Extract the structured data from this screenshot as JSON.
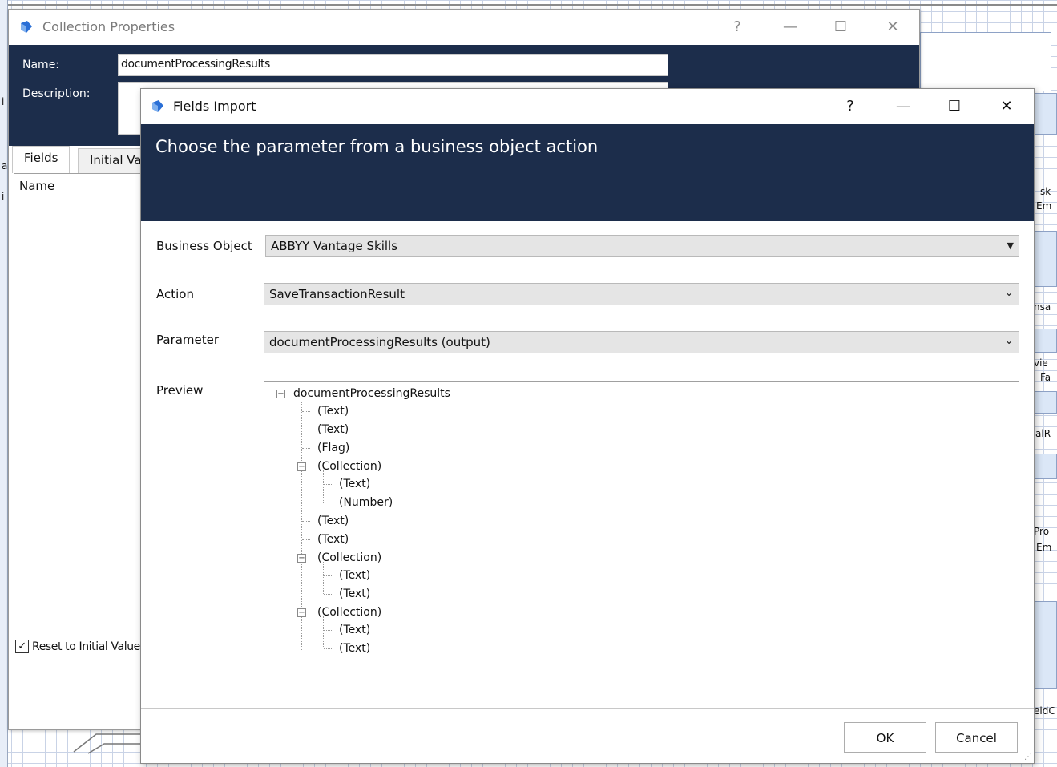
{
  "background": {
    "fragments": [
      "sk",
      "Em",
      "nsa",
      "vie",
      "Fa",
      "alR",
      "Pro",
      "Em",
      "eldC",
      "i",
      "a",
      "i"
    ]
  },
  "collection_properties": {
    "title": "Collection Properties",
    "name_label": "Name:",
    "name_value": "documentProcessingResults",
    "description_label": "Description:",
    "description_value": "",
    "tabs": [
      "Fields",
      "Initial Va"
    ],
    "list_column": "Name",
    "reset_label": "Reset to Initial Value",
    "reset_checked": "✓",
    "help": "?",
    "minimize": "—",
    "maximize": "☐",
    "close": "✕"
  },
  "fields_import": {
    "title": "Fields Import",
    "help": "?",
    "minimize": "—",
    "maximize": "☐",
    "close": "✕",
    "heading": "Choose the parameter from a business object action",
    "business_object_label": "Business Object",
    "business_object_value": "ABBYY Vantage Skills",
    "action_label": "Action",
    "action_value": "SaveTransactionResult",
    "parameter_label": "Parameter",
    "parameter_value": "documentProcessingResults (output)",
    "preview_label": "Preview",
    "tree": {
      "root": "documentProcessingResults",
      "nodes": [
        "(Text)",
        "(Text)",
        "(Flag)",
        "(Collection)",
        "(Text)",
        "(Number)",
        "(Text)",
        "(Text)",
        "(Collection)",
        "(Text)",
        "(Text)",
        "(Collection)",
        "(Text)",
        "(Text)"
      ]
    },
    "ok_label": "OK",
    "cancel_label": "Cancel",
    "expand_glyph": "−",
    "dropdown_glyph": "⌄",
    "dropdown_solid_glyph": "▼",
    "grip_glyph": "⋰"
  },
  "colors": {
    "header_navy": "#1c2d4b",
    "combo_gray": "#e5e5e5",
    "grid_blue": "#c9d3e6"
  }
}
